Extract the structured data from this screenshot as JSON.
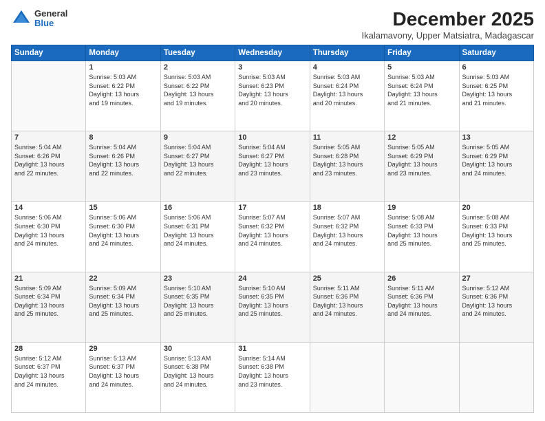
{
  "logo": {
    "general": "General",
    "blue": "Blue"
  },
  "title": {
    "month": "December 2025",
    "location": "Ikalamavony, Upper Matsiatra, Madagascar"
  },
  "weekdays": [
    "Sunday",
    "Monday",
    "Tuesday",
    "Wednesday",
    "Thursday",
    "Friday",
    "Saturday"
  ],
  "weeks": [
    [
      {
        "day": "",
        "info": ""
      },
      {
        "day": "1",
        "info": "Sunrise: 5:03 AM\nSunset: 6:22 PM\nDaylight: 13 hours\nand 19 minutes."
      },
      {
        "day": "2",
        "info": "Sunrise: 5:03 AM\nSunset: 6:22 PM\nDaylight: 13 hours\nand 19 minutes."
      },
      {
        "day": "3",
        "info": "Sunrise: 5:03 AM\nSunset: 6:23 PM\nDaylight: 13 hours\nand 20 minutes."
      },
      {
        "day": "4",
        "info": "Sunrise: 5:03 AM\nSunset: 6:24 PM\nDaylight: 13 hours\nand 20 minutes."
      },
      {
        "day": "5",
        "info": "Sunrise: 5:03 AM\nSunset: 6:24 PM\nDaylight: 13 hours\nand 21 minutes."
      },
      {
        "day": "6",
        "info": "Sunrise: 5:03 AM\nSunset: 6:25 PM\nDaylight: 13 hours\nand 21 minutes."
      }
    ],
    [
      {
        "day": "7",
        "info": "Sunrise: 5:04 AM\nSunset: 6:26 PM\nDaylight: 13 hours\nand 22 minutes."
      },
      {
        "day": "8",
        "info": "Sunrise: 5:04 AM\nSunset: 6:26 PM\nDaylight: 13 hours\nand 22 minutes."
      },
      {
        "day": "9",
        "info": "Sunrise: 5:04 AM\nSunset: 6:27 PM\nDaylight: 13 hours\nand 22 minutes."
      },
      {
        "day": "10",
        "info": "Sunrise: 5:04 AM\nSunset: 6:27 PM\nDaylight: 13 hours\nand 23 minutes."
      },
      {
        "day": "11",
        "info": "Sunrise: 5:05 AM\nSunset: 6:28 PM\nDaylight: 13 hours\nand 23 minutes."
      },
      {
        "day": "12",
        "info": "Sunrise: 5:05 AM\nSunset: 6:29 PM\nDaylight: 13 hours\nand 23 minutes."
      },
      {
        "day": "13",
        "info": "Sunrise: 5:05 AM\nSunset: 6:29 PM\nDaylight: 13 hours\nand 24 minutes."
      }
    ],
    [
      {
        "day": "14",
        "info": "Sunrise: 5:06 AM\nSunset: 6:30 PM\nDaylight: 13 hours\nand 24 minutes."
      },
      {
        "day": "15",
        "info": "Sunrise: 5:06 AM\nSunset: 6:30 PM\nDaylight: 13 hours\nand 24 minutes."
      },
      {
        "day": "16",
        "info": "Sunrise: 5:06 AM\nSunset: 6:31 PM\nDaylight: 13 hours\nand 24 minutes."
      },
      {
        "day": "17",
        "info": "Sunrise: 5:07 AM\nSunset: 6:32 PM\nDaylight: 13 hours\nand 24 minutes."
      },
      {
        "day": "18",
        "info": "Sunrise: 5:07 AM\nSunset: 6:32 PM\nDaylight: 13 hours\nand 24 minutes."
      },
      {
        "day": "19",
        "info": "Sunrise: 5:08 AM\nSunset: 6:33 PM\nDaylight: 13 hours\nand 25 minutes."
      },
      {
        "day": "20",
        "info": "Sunrise: 5:08 AM\nSunset: 6:33 PM\nDaylight: 13 hours\nand 25 minutes."
      }
    ],
    [
      {
        "day": "21",
        "info": "Sunrise: 5:09 AM\nSunset: 6:34 PM\nDaylight: 13 hours\nand 25 minutes."
      },
      {
        "day": "22",
        "info": "Sunrise: 5:09 AM\nSunset: 6:34 PM\nDaylight: 13 hours\nand 25 minutes."
      },
      {
        "day": "23",
        "info": "Sunrise: 5:10 AM\nSunset: 6:35 PM\nDaylight: 13 hours\nand 25 minutes."
      },
      {
        "day": "24",
        "info": "Sunrise: 5:10 AM\nSunset: 6:35 PM\nDaylight: 13 hours\nand 25 minutes."
      },
      {
        "day": "25",
        "info": "Sunrise: 5:11 AM\nSunset: 6:36 PM\nDaylight: 13 hours\nand 24 minutes."
      },
      {
        "day": "26",
        "info": "Sunrise: 5:11 AM\nSunset: 6:36 PM\nDaylight: 13 hours\nand 24 minutes."
      },
      {
        "day": "27",
        "info": "Sunrise: 5:12 AM\nSunset: 6:36 PM\nDaylight: 13 hours\nand 24 minutes."
      }
    ],
    [
      {
        "day": "28",
        "info": "Sunrise: 5:12 AM\nSunset: 6:37 PM\nDaylight: 13 hours\nand 24 minutes."
      },
      {
        "day": "29",
        "info": "Sunrise: 5:13 AM\nSunset: 6:37 PM\nDaylight: 13 hours\nand 24 minutes."
      },
      {
        "day": "30",
        "info": "Sunrise: 5:13 AM\nSunset: 6:38 PM\nDaylight: 13 hours\nand 24 minutes."
      },
      {
        "day": "31",
        "info": "Sunrise: 5:14 AM\nSunset: 6:38 PM\nDaylight: 13 hours\nand 23 minutes."
      },
      {
        "day": "",
        "info": ""
      },
      {
        "day": "",
        "info": ""
      },
      {
        "day": "",
        "info": ""
      }
    ]
  ]
}
